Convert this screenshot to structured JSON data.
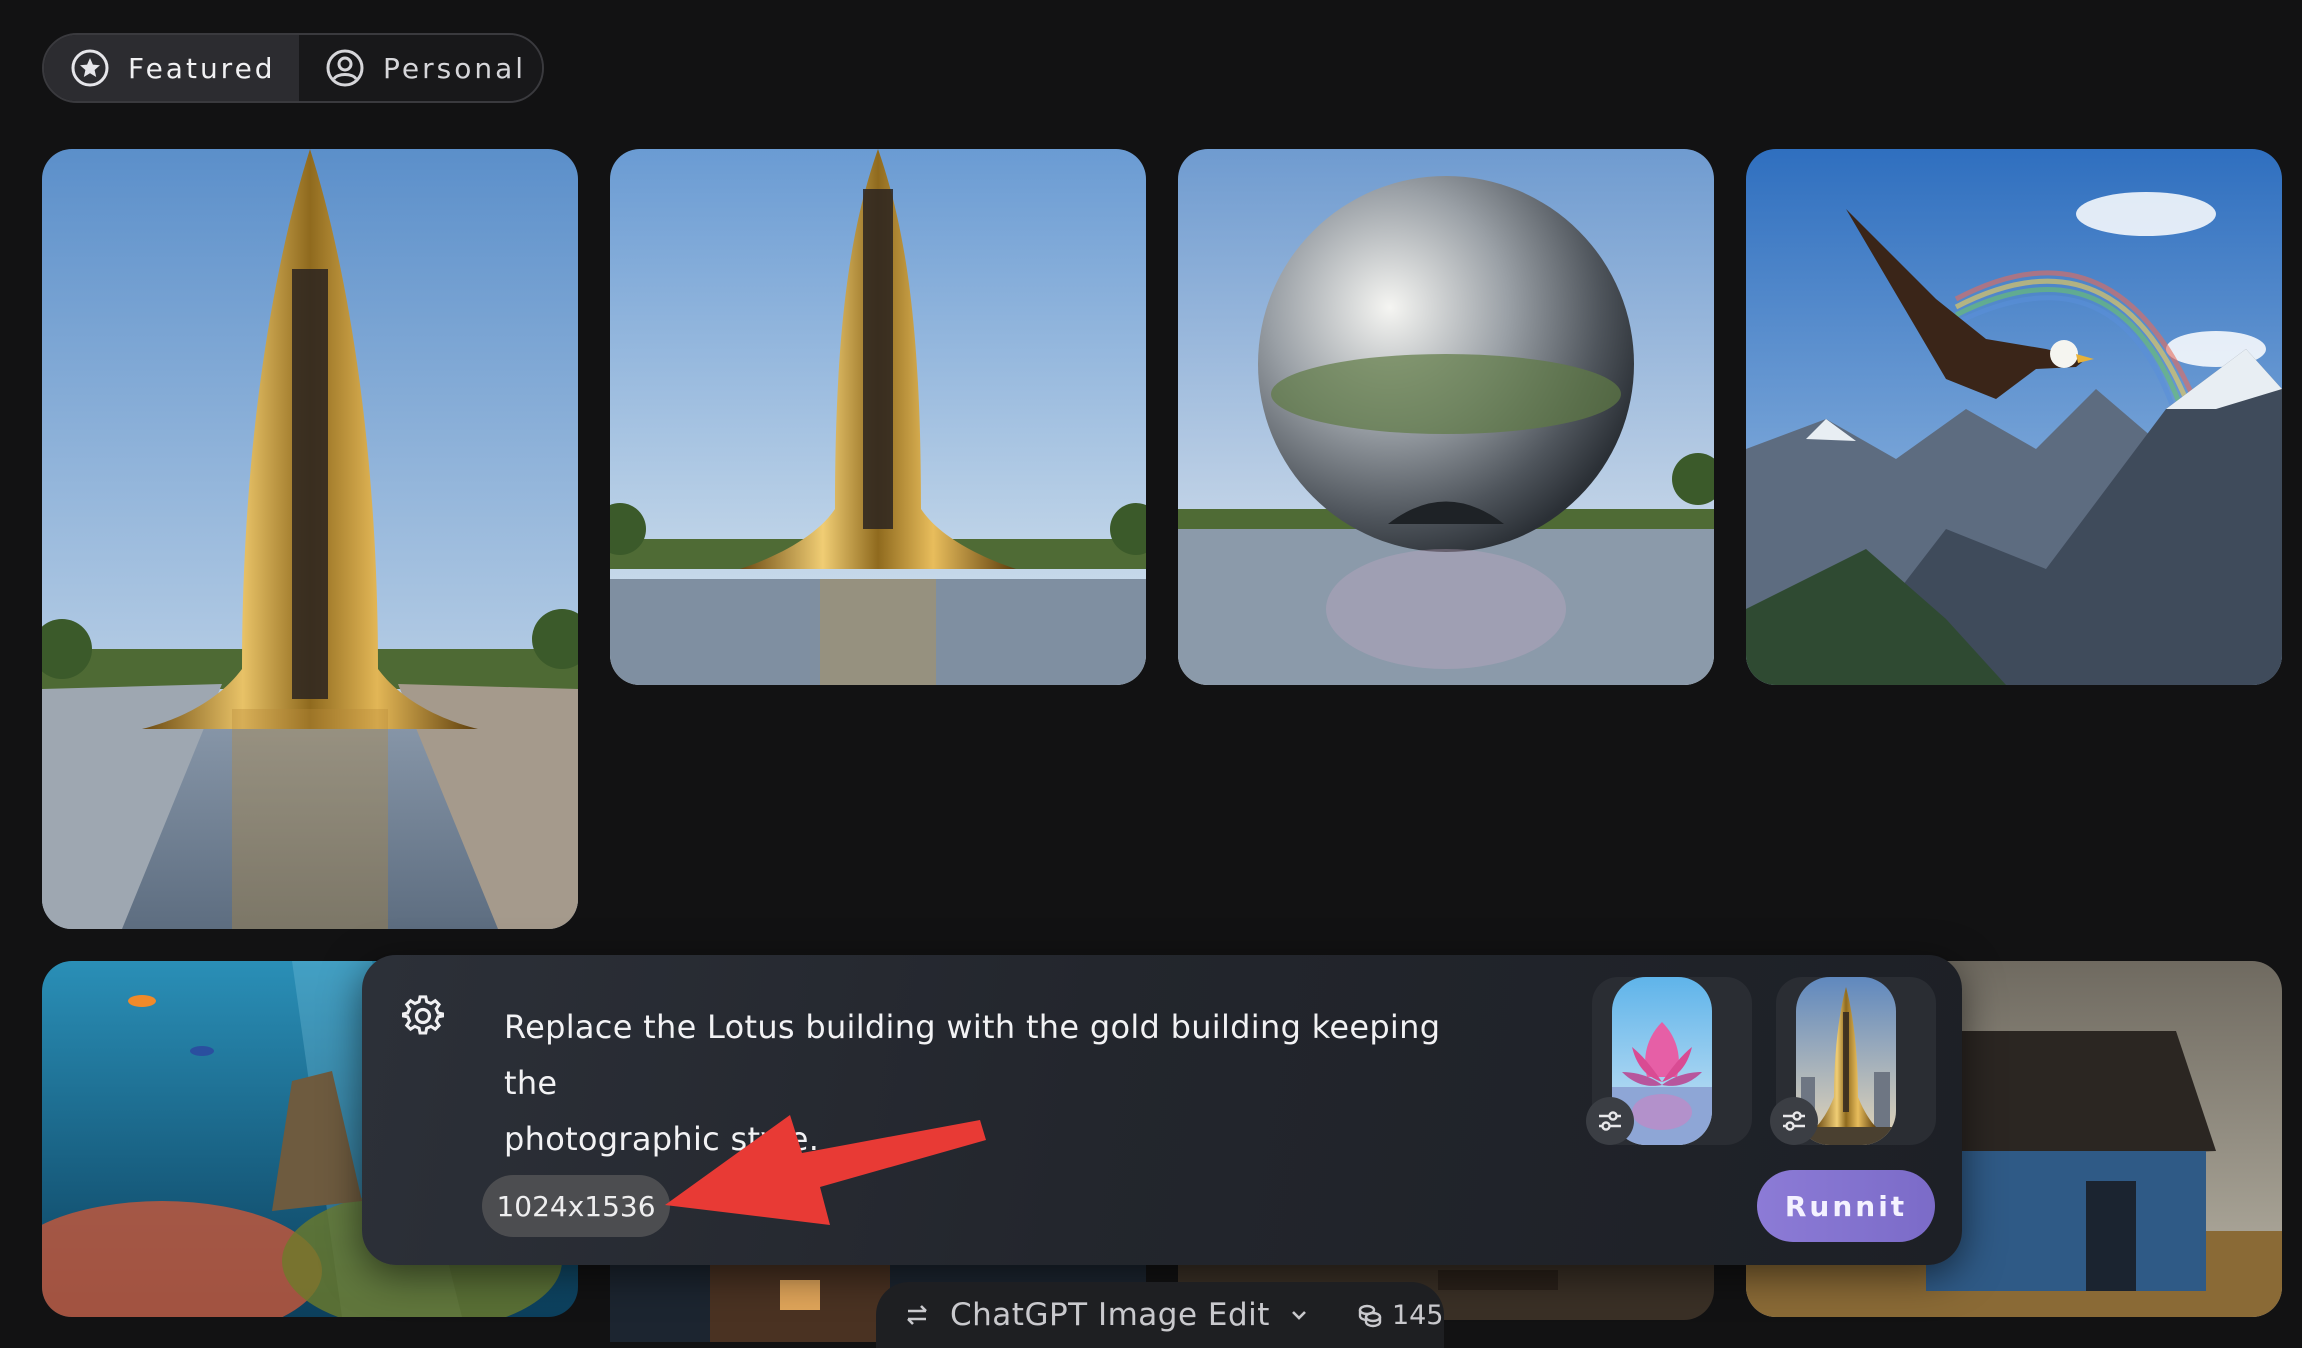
{
  "tabs": [
    {
      "label": "Featured",
      "icon": "star-icon",
      "active": true
    },
    {
      "label": "Personal",
      "icon": "user-icon",
      "active": false
    }
  ],
  "prompt": {
    "line1": "Replace the Lotus building with the gold building keeping the",
    "line2": "photographic style."
  },
  "size_chip": "1024x1536",
  "run_button": "Runnit",
  "model": {
    "name": "ChatGPT Image Edit",
    "credits": "145"
  },
  "colors": {
    "background": "#121213",
    "run_button": "#8c7bd6",
    "arrow": "#e83a35"
  }
}
